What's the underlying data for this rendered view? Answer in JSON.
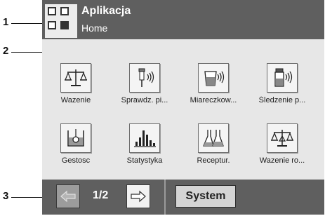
{
  "callouts": [
    {
      "number": "1",
      "target": "header"
    },
    {
      "number": "2",
      "target": "app-grid"
    },
    {
      "number": "3",
      "target": "footer-navigation"
    }
  ],
  "header": {
    "title": "Aplikacja",
    "subtitle": "Home",
    "background": "#5f5f5f",
    "text_color": "#ffffff"
  },
  "apps": [
    {
      "label": "Wazenie",
      "icon": "balance-icon"
    },
    {
      "label": "Sprawdz. pi...",
      "icon": "pipette-check-icon"
    },
    {
      "label": "Miareczkow...",
      "icon": "titration-beaker-icon"
    },
    {
      "label": "Śledzenie p...",
      "icon": "tracking-vial-icon"
    },
    {
      "label": "Gestosc",
      "icon": "density-icon"
    },
    {
      "label": "Statystyka",
      "icon": "statistics-bars-icon"
    },
    {
      "label": "Receptur.",
      "icon": "recipe-flasks-icon"
    },
    {
      "label": "Wazenie ro...",
      "icon": "differential-balance-icon"
    }
  ],
  "footer": {
    "page_indicator": "1/2",
    "prev_icon": "left-arrow-icon",
    "next_icon": "right-arrow-icon",
    "prev_enabled": false,
    "system_label": "System",
    "background": "#5f5f5f"
  }
}
